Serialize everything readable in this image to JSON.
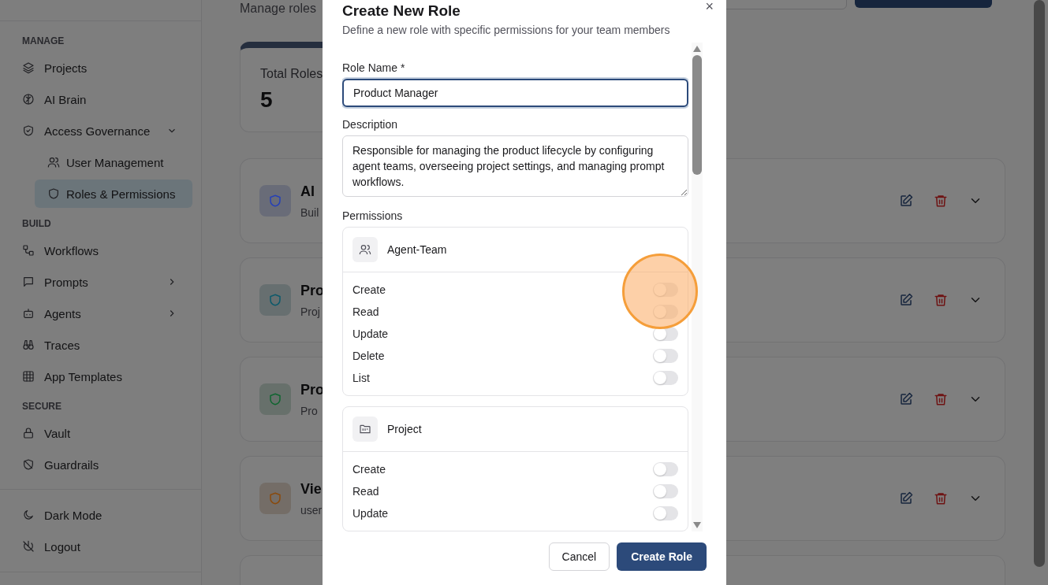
{
  "sidebar": {
    "sections": [
      {
        "title": "MANAGE",
        "items": [
          {
            "label": "Projects",
            "selected": false
          },
          {
            "label": "AI Brain",
            "selected": false
          },
          {
            "label": "Access Governance",
            "selected": false,
            "expanded": true,
            "children": [
              {
                "label": "User Management",
                "selected": false
              },
              {
                "label": "Roles & Permissions",
                "selected": true
              }
            ]
          }
        ]
      },
      {
        "title": "BUILD",
        "items": [
          {
            "label": "Workflows",
            "selected": false
          },
          {
            "label": "Prompts",
            "selected": false,
            "expanded": false
          },
          {
            "label": "Agents",
            "selected": false,
            "expanded": false
          },
          {
            "label": "Traces",
            "selected": false
          },
          {
            "label": "App Templates",
            "selected": false
          }
        ]
      },
      {
        "title": "SECURE",
        "items": [
          {
            "label": "Vault",
            "selected": false
          },
          {
            "label": "Guardrails",
            "selected": false
          }
        ]
      }
    ],
    "footer": [
      {
        "label": "Dark Mode"
      },
      {
        "label": "Logout"
      }
    ]
  },
  "header": {
    "subtitle": "Manage roles"
  },
  "stat": {
    "label": "Total Roles",
    "value": "5"
  },
  "roles": [
    {
      "name": "AI",
      "description": "Buil",
      "color": "#2540b8"
    },
    {
      "name": "Pro",
      "description": "Proj",
      "color": "#0c5a6b"
    },
    {
      "name": "Pro",
      "description": "Pro",
      "color": "#0f6630"
    },
    {
      "name": "Vie",
      "description": "user",
      "color": "#8a4a0c"
    }
  ],
  "dialog": {
    "title": "Create New Role",
    "subtitle": "Define a new role with specific permissions for your team members",
    "close": "×",
    "role_name": {
      "label": "Role Name *",
      "value": "Product Manager"
    },
    "description": {
      "label": "Description",
      "value": "Responsible for managing the product lifecycle by configuring agent teams, overseeing project settings, and managing prompt workflows."
    },
    "permissions_label": "Permissions",
    "groups": [
      {
        "name": "Agent-Team",
        "permissions": [
          {
            "label": "Create",
            "on": false
          },
          {
            "label": "Read",
            "on": false
          },
          {
            "label": "Update",
            "on": false
          },
          {
            "label": "Delete",
            "on": false
          },
          {
            "label": "List",
            "on": false
          }
        ]
      },
      {
        "name": "Project",
        "permissions": [
          {
            "label": "Create",
            "on": false
          },
          {
            "label": "Read",
            "on": false
          },
          {
            "label": "Update",
            "on": false
          }
        ]
      }
    ],
    "buttons": [
      {
        "label": "Cancel",
        "kind": "secondary"
      },
      {
        "label": "Create Role",
        "kind": "primary"
      }
    ]
  }
}
